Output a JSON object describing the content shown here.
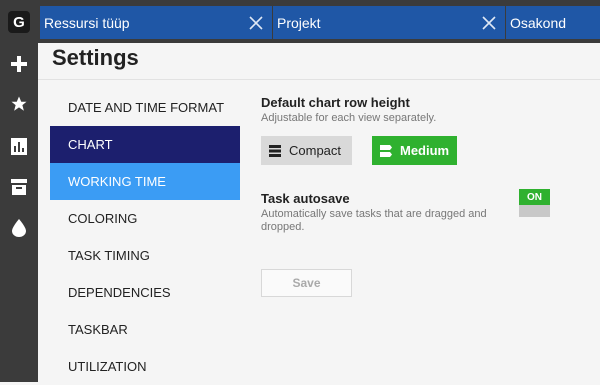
{
  "app": {
    "logo_letter": "G"
  },
  "rail": {
    "icons": [
      "plus-icon",
      "star-icon",
      "report-icon",
      "archive-icon",
      "drop-icon"
    ]
  },
  "filters": [
    {
      "label": "Ressursi tüüp"
    },
    {
      "label": "Projekt"
    },
    {
      "label": "Osakond"
    }
  ],
  "header": {
    "title": "Settings"
  },
  "nav": {
    "items": [
      {
        "label": "DATE AND TIME FORMAT"
      },
      {
        "label": "CHART"
      },
      {
        "label": "WORKING TIME"
      },
      {
        "label": "COLORING"
      },
      {
        "label": "TASK TIMING"
      },
      {
        "label": "DEPENDENCIES"
      },
      {
        "label": "TASKBAR"
      },
      {
        "label": "UTILIZATION"
      }
    ]
  },
  "chart_row_height": {
    "title": "Default chart row height",
    "subtitle": "Adjustable for each view separately.",
    "options": [
      {
        "label": "Compact",
        "selected": false
      },
      {
        "label": "Medium",
        "selected": true
      }
    ]
  },
  "autosave": {
    "title": "Task autosave",
    "subtitle": "Automatically save tasks that are dragged and dropped.",
    "toggle_label": "ON",
    "enabled": true
  },
  "save_button": {
    "label": "Save",
    "disabled": true
  },
  "colors": {
    "accent_blue": "#1f57a6",
    "nav_active": "#1c1f6e",
    "nav_hover": "#3b9cf4",
    "success_green": "#2fb12f",
    "rail": "#3b3b3b"
  }
}
